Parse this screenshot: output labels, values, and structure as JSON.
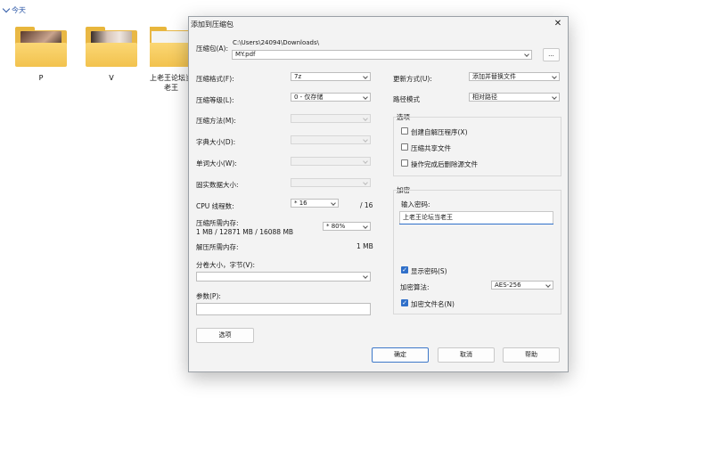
{
  "explorer": {
    "group_label": "今天",
    "items": [
      {
        "name": "P"
      },
      {
        "name": "V"
      },
      {
        "name": "上老王论坛当老王"
      }
    ]
  },
  "dialog": {
    "title": "添加到压缩包",
    "archive_label": "压缩包(A):",
    "archive_dir": "C:\\Users\\24094\\Downloads\\",
    "archive_name": "MY.pdf",
    "browse_label": "...",
    "left": {
      "format_label": "压缩格式(F):",
      "format_value": "7z",
      "level_label": "压缩等级(L):",
      "level_value": "0 - 仅存储",
      "method_label": "压缩方法(M):",
      "dict_label": "字典大小(D):",
      "word_label": "单词大小(W):",
      "solid_label": "固实数据大小:",
      "cpu_label": "CPU 线程数:",
      "cpu_value": "* 16",
      "cpu_total": "/ 16",
      "mem_label": "压缩所需内存:",
      "mem_detail": "1 MB / 12871 MB / 16088 MB",
      "mem_percent": "* 80%",
      "decomp_label": "解压所需内存:",
      "decomp_value": "1 MB",
      "split_label": "分卷大小，字节(V):",
      "split_value": "",
      "params_label": "参数(P):",
      "params_value": "",
      "options_button": "选项"
    },
    "right": {
      "update_label": "更新方式(U):",
      "update_value": "添加并替换文件",
      "path_label": "路径模式",
      "path_value": "相对路径",
      "options_group": "选项",
      "opt_sfx": "创建自解压程序(X)",
      "opt_shared": "压缩共享文件",
      "opt_delete": "操作完成后删除源文件",
      "enc_group": "加密",
      "pwd_label": "输入密码:",
      "pwd_value": "上老王论坛当老王",
      "show_pwd": "显示密码(S)",
      "enc_method_label": "加密算法:",
      "enc_method_value": "AES-256",
      "enc_names": "加密文件名(N)"
    },
    "buttons": {
      "ok": "确定",
      "cancel": "取消",
      "help": "帮助"
    }
  }
}
